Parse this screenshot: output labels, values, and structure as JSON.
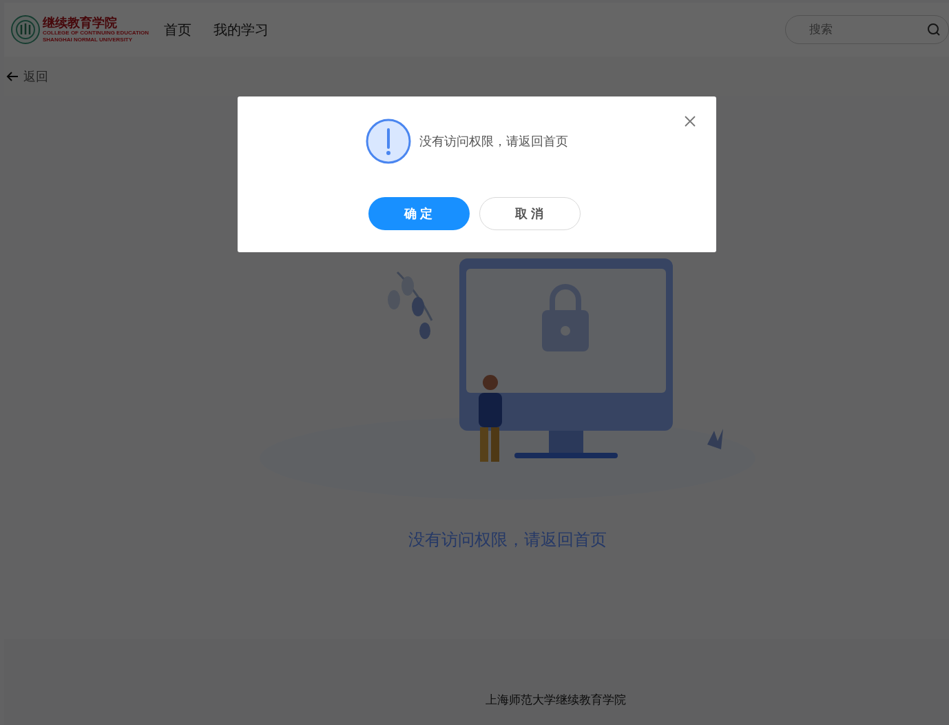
{
  "header": {
    "logo": {
      "title": "继续教育学院",
      "subtitle_1": "COLLEGE OF CONTINUING EDUCATION",
      "subtitle_2": "SHANGHAI NORMAL UNIVERSITY"
    },
    "nav": [
      "首页",
      "我的学习"
    ],
    "search": {
      "placeholder": "搜索"
    }
  },
  "back": {
    "label": "返回"
  },
  "empty_state": {
    "message": "没有访问权限，请返回首页"
  },
  "footer": {
    "text": "上海师范大学继续教育学院"
  },
  "dialog": {
    "message": "没有访问权限，请返回首页",
    "buttons": [
      {
        "label": "确 定",
        "kind": "primary"
      },
      {
        "label": "取 消",
        "kind": "secondary"
      }
    ]
  }
}
